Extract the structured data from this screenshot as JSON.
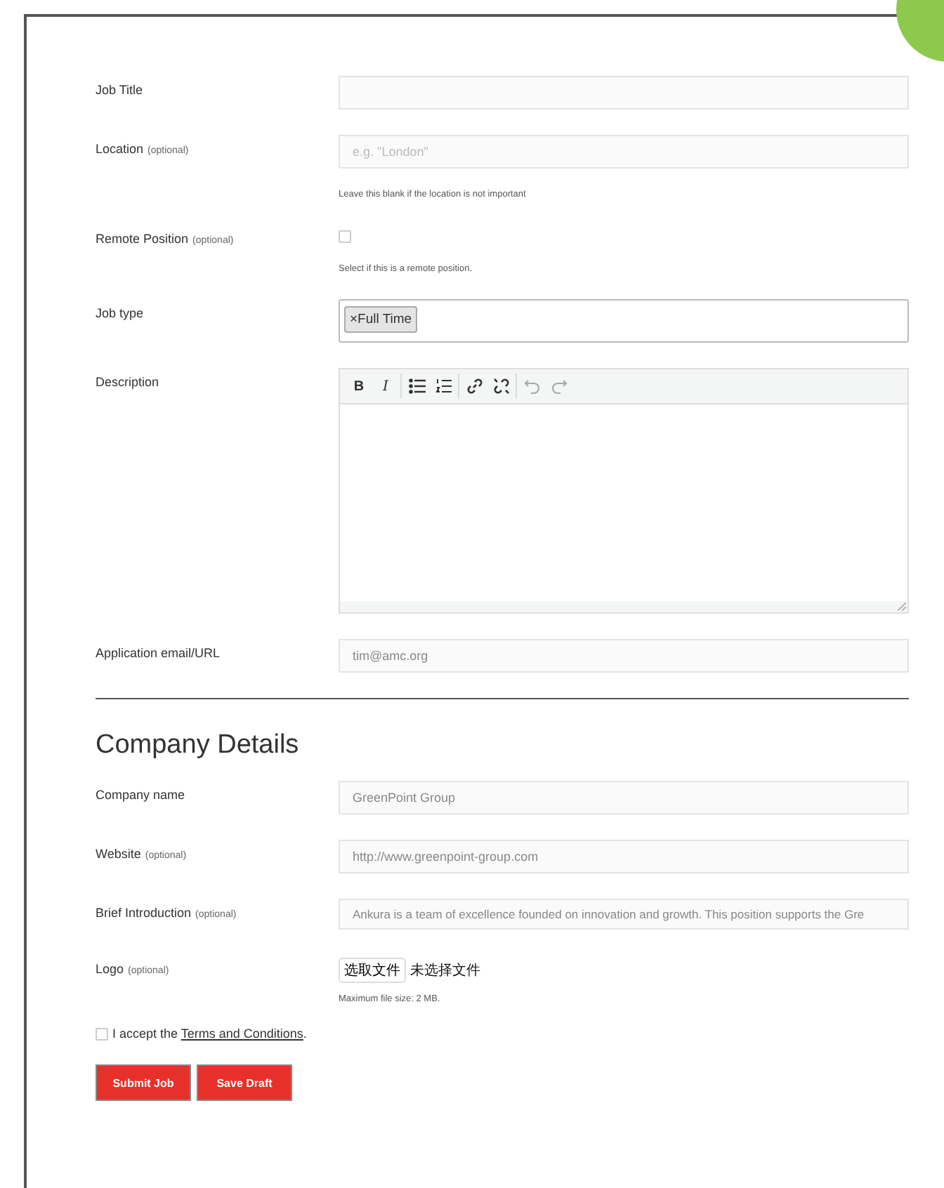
{
  "job_fields": [
    {
      "kind": "text",
      "label": "Job Title"
    },
    {
      "kind": "text",
      "label": "Location",
      "optional": "(optional)",
      "placeholder": "e.g. \"London\"",
      "hint": "Leave this blank if the location is not important"
    },
    {
      "kind": "checkbox",
      "label": "Remote Position",
      "optional": "(optional)",
      "checked": false,
      "hint": "Select if this is a remote position."
    },
    {
      "kind": "tags",
      "label": "Job type",
      "tags": [
        {
          "remove": "×",
          "label": "Full Time"
        }
      ]
    },
    {
      "kind": "editor",
      "label": "Description",
      "toolbar": [
        {
          "buttons": [
            {
              "kind": "bold",
              "label": "B",
              "disabled": false
            },
            {
              "kind": "italic",
              "label": "I",
              "disabled": false
            }
          ]
        },
        {
          "buttons": [
            {
              "kind": "bullet-list",
              "disabled": false
            },
            {
              "kind": "numbered-list",
              "disabled": false
            }
          ]
        },
        {
          "buttons": [
            {
              "kind": "link",
              "disabled": false
            },
            {
              "kind": "unlink",
              "disabled": false
            }
          ]
        },
        {
          "buttons": [
            {
              "kind": "undo",
              "disabled": true
            },
            {
              "kind": "redo",
              "disabled": true
            }
          ]
        }
      ]
    },
    {
      "kind": "text",
      "label": "Application email/URL",
      "value": "tim@amc.org"
    }
  ],
  "company": {
    "heading": "Company Details",
    "fields": [
      {
        "kind": "text",
        "label": "Company name",
        "value": "GreenPoint Group"
      },
      {
        "kind": "text",
        "label": "Website",
        "optional": "(optional)",
        "value": "http://www.greenpoint-group.com"
      },
      {
        "kind": "text",
        "label": "Brief Introduction",
        "optional": "(optional)",
        "value": "Ankura is a team of excellence founded on innovation and growth. This position supports the Gre"
      },
      {
        "kind": "file",
        "label": "Logo",
        "optional": "(optional)",
        "button": "选取文件",
        "status": "未选择文件",
        "hint": "Maximum file size: 2 MB."
      }
    ]
  },
  "terms": {
    "checked": false,
    "before": "I accept the",
    "link": "Terms and Conditions",
    "after": "."
  },
  "buttons": [
    "Submit Job",
    "Save Draft"
  ]
}
